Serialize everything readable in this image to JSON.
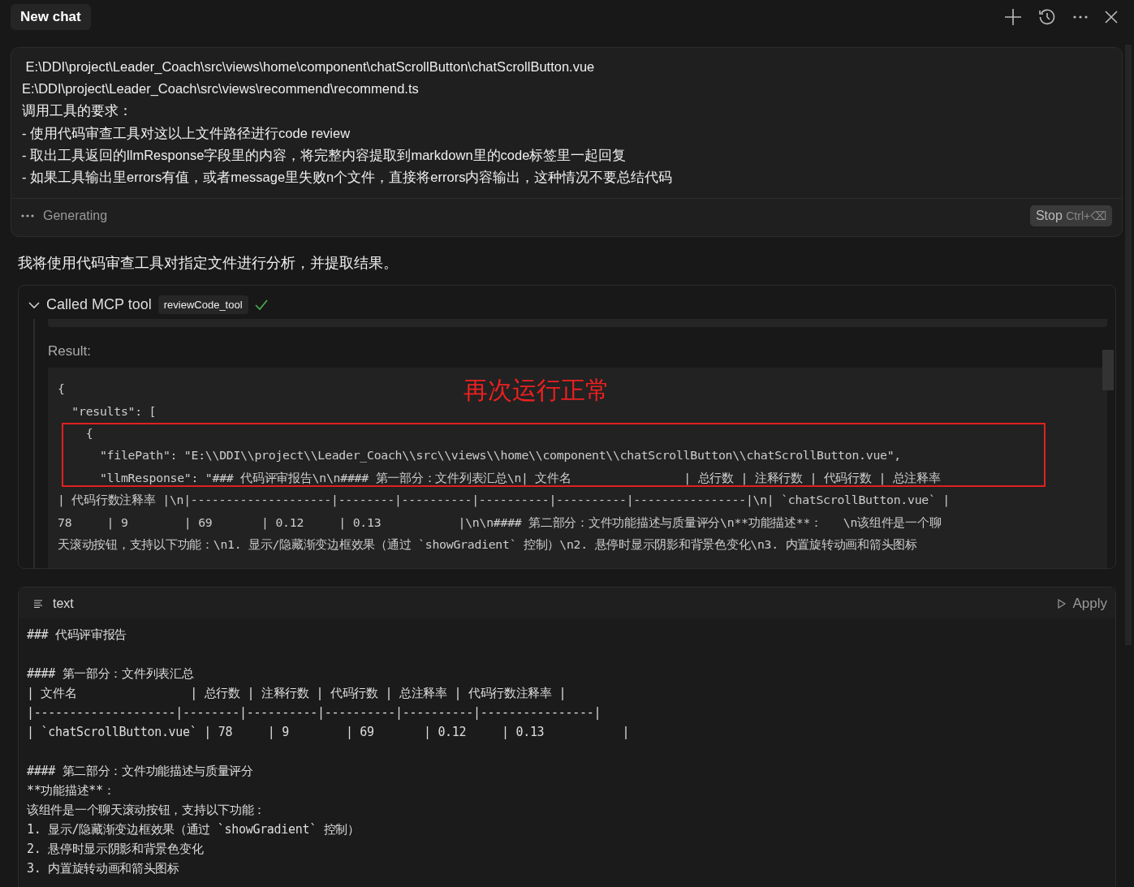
{
  "header": {
    "title": "New chat"
  },
  "prompt": {
    "lines": [
      " E:\\DDI\\project\\Leader_Coach\\src\\views\\home\\component\\chatScrollButton\\chatScrollButton.vue",
      "E:\\DDI\\project\\Leader_Coach\\src\\views\\recommend\\recommend.ts",
      "调用工具的要求：",
      "- 使用代码审查工具对这以上文件路径进行code review",
      "- 取出工具返回的llmResponse字段里的内容，将完整内容提取到markdown里的code标签里一起回复",
      "- 如果工具输出里errors有值，或者message里失败n个文件，直接将errors内容输出，这种情况不要总结代码"
    ],
    "status": "Generating",
    "stop_label": "Stop",
    "stop_shortcut": "Ctrl+⌫"
  },
  "reply": "我将使用代码审查工具对指定文件进行分析，并提取结果。",
  "tool_call": {
    "expanded": true,
    "label": "Called MCP tool",
    "tool": "reviewCode_tool",
    "success": true,
    "result_label": "Result:",
    "result_lines": [
      "{",
      "  \"results\": [",
      "    {",
      "      \"filePath\": \"E:\\\\DDI\\\\project\\\\Leader_Coach\\\\src\\\\views\\\\home\\\\component\\\\chatScrollButton\\\\chatScrollButton.vue\",",
      "      \"llmResponse\": \"### 代码评审报告\\n\\n#### 第一部分：文件列表汇总\\n| 文件名                | 总行数 | 注释行数 | 代码行数 | 总注释率",
      "| 代码行数注释率 |\\n|--------------------|--------|----------|----------|----------|----------------|\\n| `chatScrollButton.vue` |",
      "78     | 9        | 69       | 0.12     | 0.13           |\\n\\n#### 第二部分：文件功能描述与质量评分\\n**功能描述**：   \\n该组件是一个聊",
      "天滚动按钮，支持以下功能：\\n1. 显示/隐藏渐变边框效果（通过 `showGradient` 控制）\\n2. 悬停时显示阴影和背景色变化\\n3. 内置旋转动画和箭头图标"
    ],
    "annotation": "再次运行正常"
  },
  "code_block": {
    "language": "text",
    "apply_label": "Apply",
    "paragraphs": [
      [
        "### 代码评审报告"
      ],
      [
        "#### 第一部分：文件列表汇总",
        "| 文件名                | 总行数 | 注释行数 | 代码行数 | 总注释率 | 代码行数注释率 |",
        "|--------------------|--------|----------|----------|----------|----------------|",
        "| `chatScrollButton.vue` | 78     | 9        | 69       | 0.12     | 0.13           |"
      ],
      [
        "#### 第二部分：文件功能描述与质量评分",
        "**功能描述**：",
        "该组件是一个聊天滚动按钮，支持以下功能：",
        "1. 显示/隐藏渐变边框效果（通过 `showGradient` 控制）",
        "2. 悬停时显示阴影和背景色变化",
        "3. 内置旋转动画和箭头图标"
      ]
    ]
  }
}
